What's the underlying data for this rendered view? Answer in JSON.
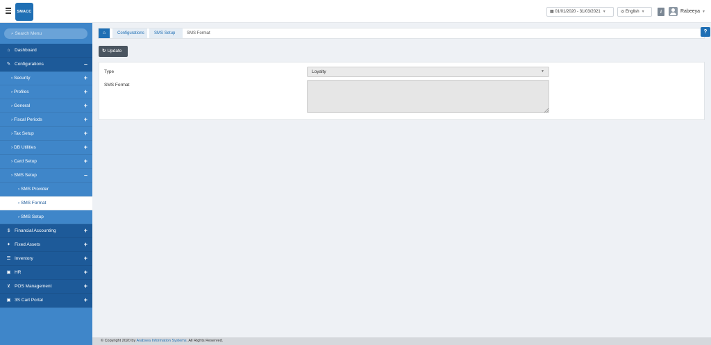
{
  "brand": {
    "logo_text": "SMACC"
  },
  "topbar": {
    "date_range": "01/01/2020 - 31/03/2021",
    "language": "English",
    "info_glyph": "i",
    "user_name": "Rabeeya"
  },
  "sidebar": {
    "search_placeholder": "Search Menu",
    "items": [
      {
        "label": "Dashboard",
        "icon": "home-icon",
        "glyph": "⌂",
        "toggle": ""
      },
      {
        "label": "Configurations",
        "icon": "wrench-icon",
        "glyph": "✎",
        "toggle": "–"
      },
      {
        "label": "Security",
        "glyph": "›",
        "toggle": "+"
      },
      {
        "label": "Profiles",
        "glyph": "›",
        "toggle": "+"
      },
      {
        "label": "General",
        "glyph": "›",
        "toggle": "+"
      },
      {
        "label": "Fiscal Periods",
        "glyph": "›",
        "toggle": "+"
      },
      {
        "label": "Tax Setup",
        "glyph": "›",
        "toggle": "+"
      },
      {
        "label": "DB Utilities",
        "glyph": "›",
        "toggle": "+"
      },
      {
        "label": "Card Setup",
        "glyph": "›",
        "toggle": "+"
      },
      {
        "label": "SMS Setup",
        "glyph": "›",
        "toggle": "–"
      },
      {
        "label": "SMS Provider",
        "glyph": "›",
        "toggle": ""
      },
      {
        "label": "SMS Format",
        "glyph": "›",
        "toggle": ""
      },
      {
        "label": "SMS Setup",
        "glyph": "›",
        "toggle": ""
      },
      {
        "label": "Financial Accounting",
        "icon": "dollar-icon",
        "glyph": "$",
        "toggle": "+"
      },
      {
        "label": "Fixed Assets",
        "icon": "pin-icon",
        "glyph": "✦",
        "toggle": "+"
      },
      {
        "label": "Inventory",
        "icon": "list-icon",
        "glyph": "☰",
        "toggle": "+"
      },
      {
        "label": "HR",
        "icon": "id-card-icon",
        "glyph": "▣",
        "toggle": "+"
      },
      {
        "label": "POS Management",
        "icon": "cart-icon",
        "glyph": "⊻",
        "toggle": "+"
      },
      {
        "label": "3S Cart Portal",
        "icon": "id-card-icon",
        "glyph": "▣",
        "toggle": "+"
      }
    ]
  },
  "breadcrumb": {
    "home_glyph": "⌂",
    "items": [
      "Configurations",
      "SMS Setup",
      "SMS Format"
    ]
  },
  "help_glyph": "?",
  "toolbar": {
    "update_label": "Update",
    "update_glyph": "↻"
  },
  "form": {
    "type_label": "Type",
    "type_value": "Loyalty",
    "sms_format_label": "SMS Format",
    "sms_format_value": ""
  },
  "footer": {
    "prefix": "© Copyright 2020 by ",
    "org": "Arabsea Information Systems",
    "suffix": ". All Rights Reserved."
  },
  "colors": {
    "primary": "#1f6fb4",
    "sidebar": "#3f86c9",
    "sidebar_top": "#1d5a99"
  }
}
